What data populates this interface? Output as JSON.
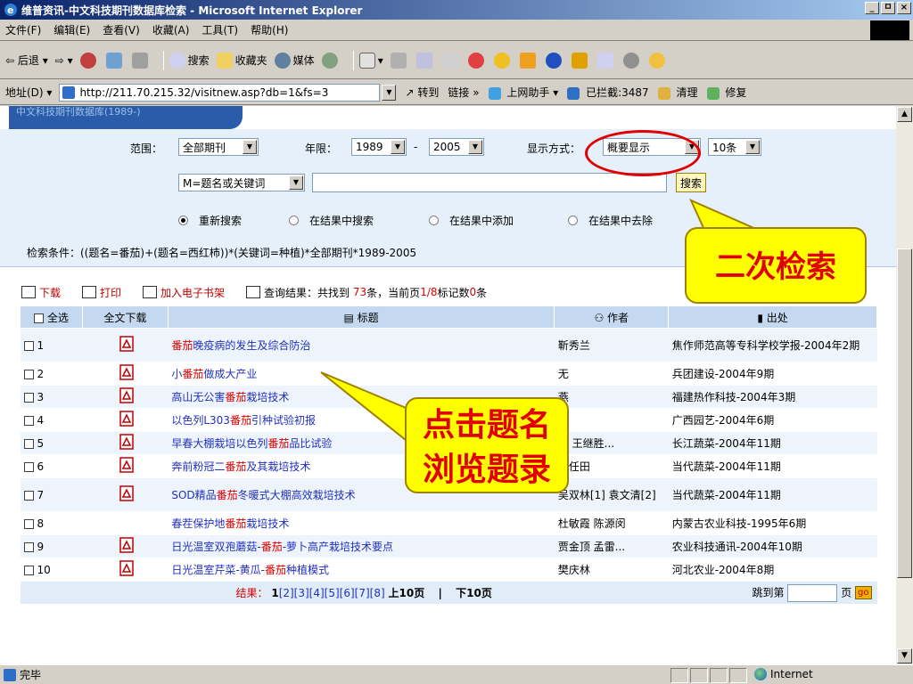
{
  "window": {
    "title": "维普资讯-中文科技期刊数据库检索 - Microsoft Internet Explorer",
    "controls": [
      "_",
      "ㅁ",
      "×"
    ]
  },
  "menu": [
    "文件(F)",
    "编辑(E)",
    "查看(V)",
    "收藏(A)",
    "工具(T)",
    "帮助(H)"
  ],
  "toolbar": {
    "back": "后退",
    "search": "搜索",
    "favorites": "收藏夹",
    "media": "媒体"
  },
  "address": {
    "label": "地址(D)",
    "url": "http://211.70.215.32/visitnew.asp?db=1&fs=3",
    "go": "转到",
    "links": "链接",
    "helper": "上网助手",
    "blocked": "已拦截:3487",
    "clean": "清理",
    "repair": "修复"
  },
  "banner": {
    "text": "中文科技期刊数据库(1989-)"
  },
  "search": {
    "range_label": "范围：",
    "range_value": "全部期刊",
    "years_label": "年限：",
    "year_from": "1989",
    "year_sep": "-",
    "year_to": "2005",
    "display_label": "显示方式：",
    "display_value": "概要显示",
    "per_page": "10条",
    "field_value": "M=题名或关键词",
    "query": "",
    "button": "搜索",
    "modes": [
      "重新搜索",
      "在结果中搜索",
      "在结果中添加",
      "在结果中去除"
    ],
    "selected_mode": 0,
    "criteria": "检索条件：((题名=番茄)+(题名=西红柿))*(关键词=种植)*全部期刊*1989-2005"
  },
  "actions": {
    "download": "下载",
    "print": "打印",
    "bookshelf": "加入电子书架",
    "result_prefix": "查询结果：共找到",
    "total": "73",
    "result_mid": "条，当前页",
    "page": "1/8",
    "marked_mid": "标记数",
    "marked": "0",
    "marked_suffix": "条"
  },
  "table": {
    "headers": {
      "select_all": "全选",
      "fulltext": "全文下载",
      "title": "标题",
      "author": "作者",
      "source": "出处"
    },
    "rows": [
      {
        "no": "1",
        "pdf": true,
        "pre": "",
        "hl": "番茄",
        "post": "晚疫病的发生及综合防治",
        "author": "靳秀兰",
        "source": "焦作师范高等专科学校学报-2004年2期"
      },
      {
        "no": "2",
        "pdf": true,
        "pre": "小",
        "hl": "番茄",
        "post": "做成大产业",
        "author": "无",
        "source": "兵团建设-2004年9期"
      },
      {
        "no": "3",
        "pdf": true,
        "pre": "高山无公害",
        "hl": "番茄",
        "post": "栽培技术",
        "author": "燕",
        "source": "福建热作科技-2004年3期"
      },
      {
        "no": "4",
        "pdf": true,
        "pre": "以色列L303",
        "hl": "番茄",
        "post": "引种试验初报",
        "author": "能",
        "source": "广西园艺-2004年6期"
      },
      {
        "no": "5",
        "pdf": true,
        "pre": "早春大棚栽培以色列",
        "hl": "番茄",
        "post": "品比试验",
        "author": "友 王继胜...",
        "source": "长江蔬菜-2004年11期"
      },
      {
        "no": "6",
        "pdf": true,
        "pre": "奔前粉冠二",
        "hl": "番茄",
        "post": "及其栽培技术",
        "author": "郭任田",
        "source": "当代蔬菜-2004年11期"
      },
      {
        "no": "7",
        "pdf": true,
        "pre": "SOD精品",
        "hl": "番茄",
        "post": "冬暖式大棚高效栽培技术",
        "author": "吴双林[1] 袁文清[2]",
        "source": "当代蔬菜-2004年11期"
      },
      {
        "no": "8",
        "pdf": false,
        "pre": "春茬保护地",
        "hl": "番茄",
        "post": "栽培技术",
        "author": "杜敏霞 陈源闵",
        "source": "内蒙古农业科技-1995年6期"
      },
      {
        "no": "9",
        "pdf": true,
        "pre": "日光温室双孢蘑菇-",
        "hl": "番茄",
        "post": "-萝卜高产栽培技术要点",
        "author": "贾金顶 孟雷...",
        "source": "农业科技通讯-2004年10期"
      },
      {
        "no": "10",
        "pdf": true,
        "pre": "日光温室芹菜-黄瓜-",
        "hl": "番茄",
        "post": "种植模式",
        "author": "樊庆林",
        "source": "河北农业-2004年8期"
      }
    ],
    "pager": {
      "label": "结果：",
      "current": "1",
      "pages": "[2][3][4][5][6][7][8]",
      "prev10": "上10页",
      "sep": "|",
      "next10": "下10页",
      "jump_label": "跳到第",
      "jump_suffix": "页",
      "go": "go"
    }
  },
  "annotations": {
    "secondary_search": "二次检索",
    "click_title_line1": "点击题名",
    "click_title_line2": "浏览题录"
  },
  "status": {
    "text": "完毕",
    "zone": "Internet"
  }
}
